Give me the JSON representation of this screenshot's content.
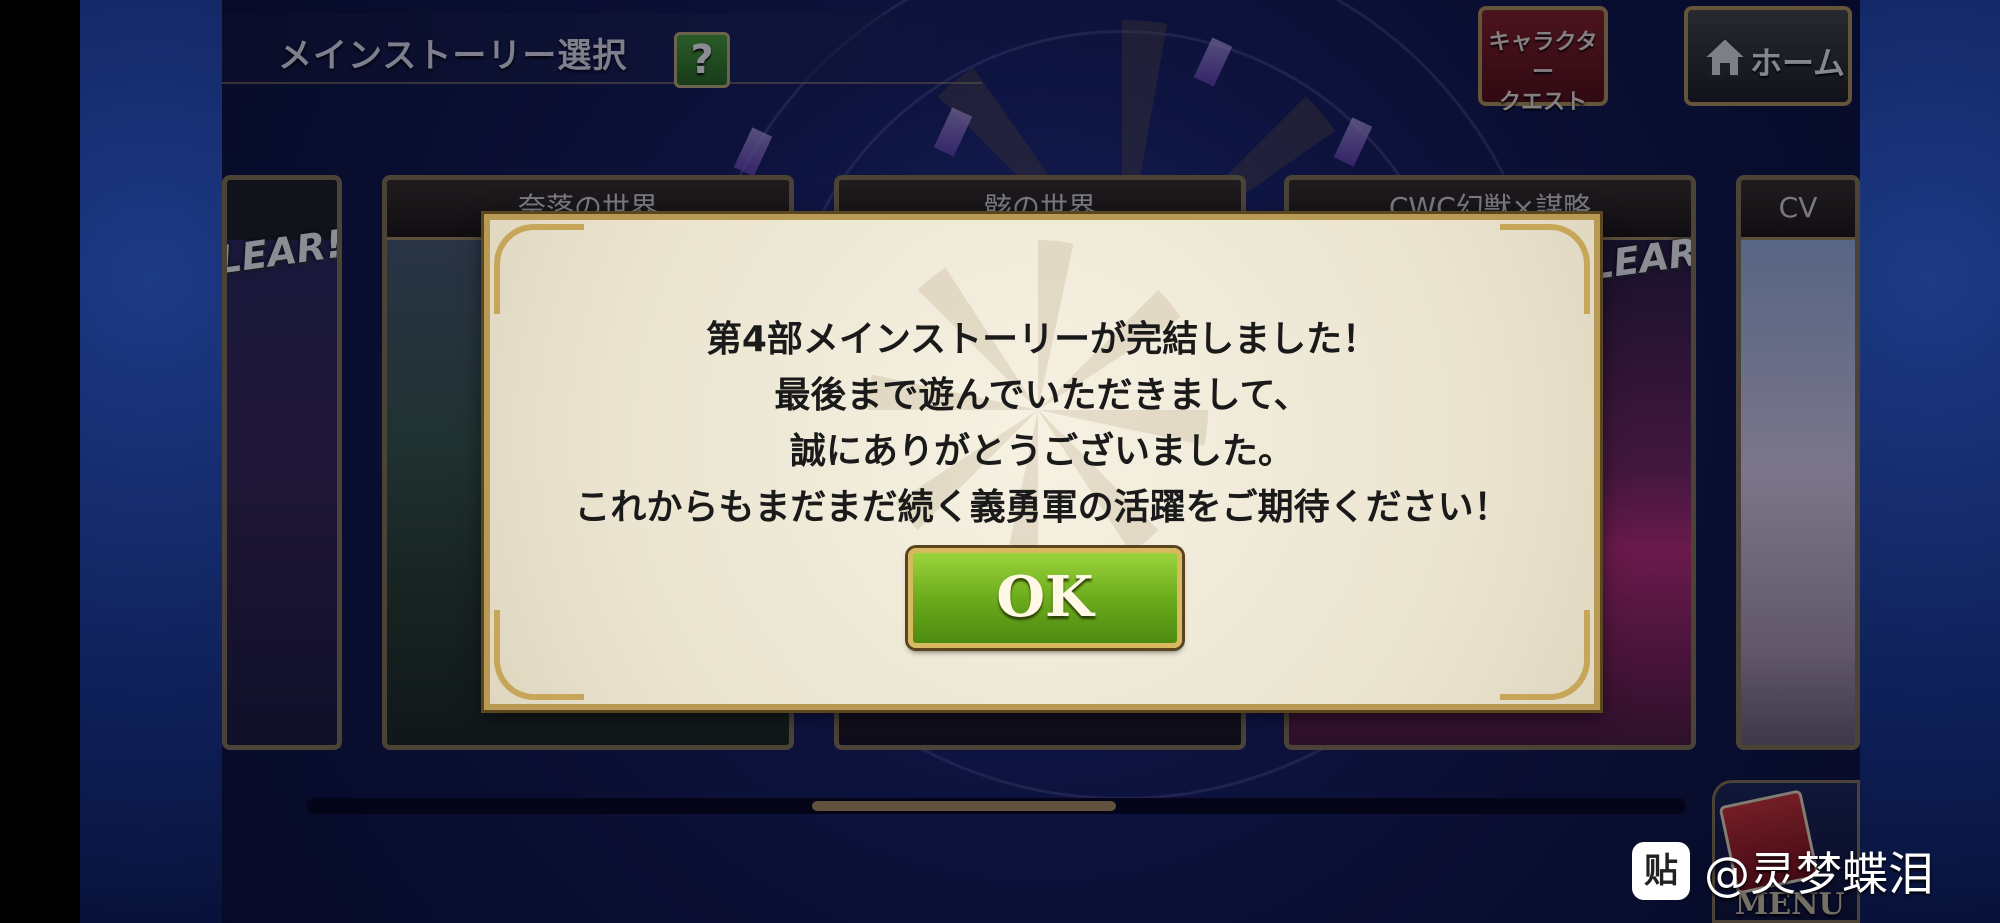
{
  "header": {
    "title": "メインストーリー選択",
    "help_label": "?",
    "character_quest_line1": "キャラクター",
    "character_quest_line2": "クエスト",
    "home_label": "ホーム"
  },
  "cards": [
    {
      "title": "",
      "clear": "LEAR!"
    },
    {
      "title": "奈落の世界",
      "clear": ""
    },
    {
      "title": "骸の世界",
      "clear": ""
    },
    {
      "title": "CWC幻獣×謀略",
      "clear": "LEAR!"
    },
    {
      "title": "CV",
      "clear": ""
    }
  ],
  "scroll": {
    "position": 0.47,
    "size": 0.22
  },
  "menu": {
    "label": "MENU"
  },
  "dialog": {
    "lines": [
      "第4部メインストーリーが完結しました！",
      "最後まで遊んでいただきまして、",
      "誠にありがとうございました。",
      "これからもまだまだ続く義勇軍の活躍をご期待ください！"
    ],
    "ok_label": "OK"
  },
  "watermark": {
    "logo": "贴",
    "text": "@灵梦蝶泪"
  },
  "colors": {
    "accent_gold": "#b99a54",
    "ok_green": "#6cac1c",
    "dialog_bg": "#f6f1e2"
  }
}
